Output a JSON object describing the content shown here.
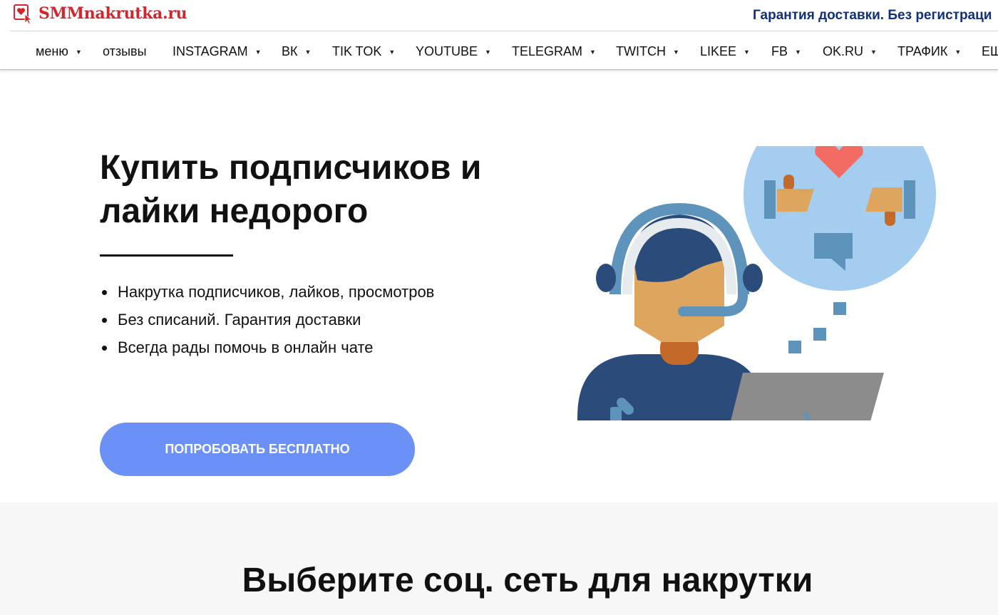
{
  "header": {
    "logo_text": "SMMnakrutka.ru",
    "guarantee_text": "Гарантия доставки. Без регистраци"
  },
  "nav": {
    "items": [
      {
        "label": "меню",
        "has_dropdown": true
      },
      {
        "label": "отзывы",
        "has_dropdown": false
      },
      {
        "label": "INSTAGRAM",
        "has_dropdown": true
      },
      {
        "label": "ВК",
        "has_dropdown": true
      },
      {
        "label": "TIK TOK",
        "has_dropdown": true
      },
      {
        "label": "YOUTUBE",
        "has_dropdown": true
      },
      {
        "label": "TELEGRAM",
        "has_dropdown": true
      },
      {
        "label": "TWITCH",
        "has_dropdown": true
      },
      {
        "label": "LIKEE",
        "has_dropdown": true
      },
      {
        "label": "FB",
        "has_dropdown": true
      },
      {
        "label": "OK.RU",
        "has_dropdown": true
      },
      {
        "label": "ТРАФИК",
        "has_dropdown": true
      },
      {
        "label": "ЕЩ",
        "has_dropdown": false
      }
    ],
    "dropdown_icon": "caret-down-icon"
  },
  "hero": {
    "title_line1": "Купить подписчиков и",
    "title_line2": "лайки недорого",
    "features": [
      "Накрутка подписчиков, лайков, просмотров",
      "Без списаний. Гарантия доставки",
      "Всегда рады помочь в онлайн чате"
    ],
    "cta_label": "ПОПРОБОВАТЬ БЕСПЛАТНО",
    "illustration_icon": "support-operator-illustration"
  },
  "section2": {
    "title": "Выберите соц. сеть для накрутки"
  },
  "colors": {
    "brand_red": "#d0262c",
    "guarantee_blue": "#10307a",
    "cta_blue": "#6b91f7",
    "section_bg": "#f7f7f7"
  }
}
